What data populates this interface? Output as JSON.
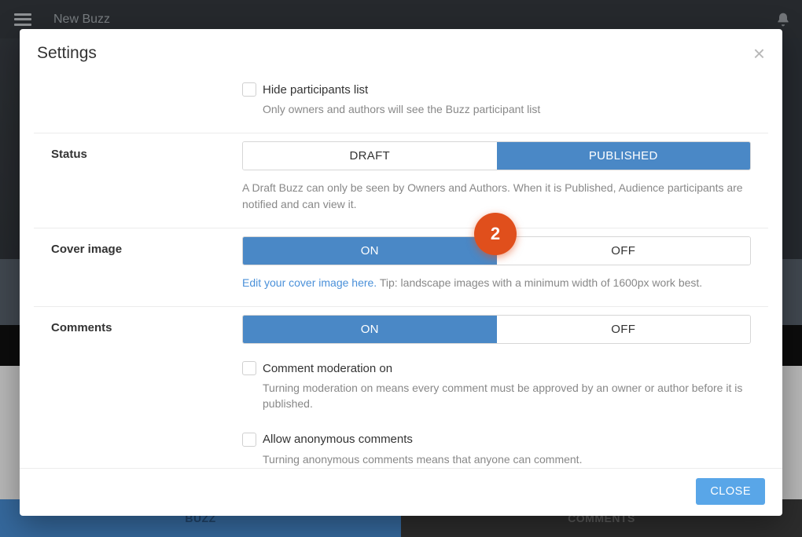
{
  "topbar": {
    "title": "New Buzz"
  },
  "bg_tabs": {
    "buzz": "BUZZ",
    "comments": "COMMENTS"
  },
  "modal": {
    "title": "Settings",
    "close_btn": "CLOSE",
    "badge": "2",
    "participants": {
      "checkbox_label": "Hide participants list",
      "help": "Only owners and authors will see the Buzz participant list"
    },
    "status": {
      "label": "Status",
      "opt_draft": "DRAFT",
      "opt_published": "PUBLISHED",
      "help": "A Draft Buzz can only be seen by Owners and Authors. When it is Published, Audience participants are notified and can view it."
    },
    "cover": {
      "label": "Cover image",
      "opt_on": "ON",
      "opt_off": "OFF",
      "link": "Edit your cover image here.",
      "tip": " Tip: landscape images with a minimum width of 1600px work best."
    },
    "comments": {
      "label": "Comments",
      "opt_on": "ON",
      "opt_off": "OFF",
      "moderation_label": "Comment moderation on",
      "moderation_help": "Turning moderation on means every comment must be approved by an owner or author before it is published.",
      "anon_label": "Allow anonymous comments",
      "anon_help": "Turning anonymous comments means that anyone can comment."
    }
  }
}
